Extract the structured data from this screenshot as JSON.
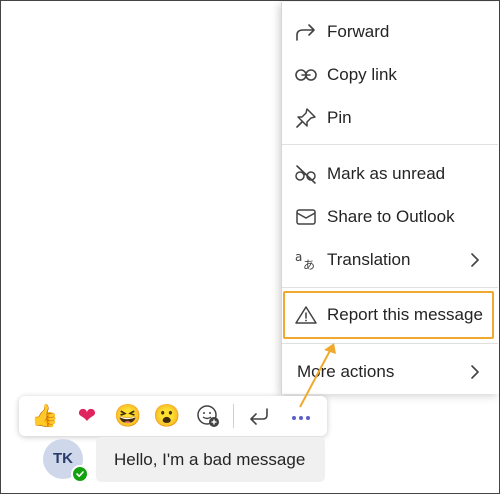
{
  "menu": {
    "items": [
      {
        "label": "Forward",
        "icon": "forward-icon"
      },
      {
        "label": "Copy link",
        "icon": "link-icon"
      },
      {
        "label": "Pin",
        "icon": "pin-icon"
      },
      {
        "label": "Mark as unread",
        "icon": "glasses-slash-icon"
      },
      {
        "label": "Share to Outlook",
        "icon": "mail-icon"
      },
      {
        "label": "Translation",
        "icon": "translate-icon"
      },
      {
        "label": "Report this message",
        "icon": "warning-icon"
      },
      {
        "label": "More actions",
        "icon": ""
      }
    ]
  },
  "reactions": [
    {
      "name": "like",
      "glyph": "👍"
    },
    {
      "name": "heart",
      "glyph": "❤"
    },
    {
      "name": "laugh",
      "glyph": "😆"
    },
    {
      "name": "surprised",
      "glyph": "😮"
    }
  ],
  "chat": {
    "avatar_initials": "TK",
    "message": "Hello, I'm a bad message"
  },
  "colors": {
    "highlight": "#f0a92e",
    "accent": "#5b5fc7",
    "presence": "#13a10e"
  }
}
